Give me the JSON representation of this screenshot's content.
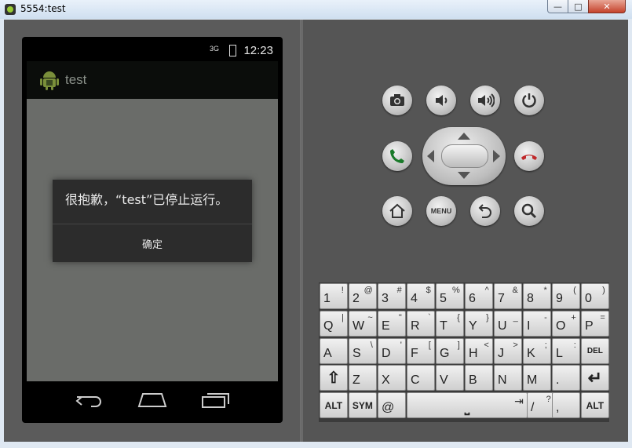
{
  "window": {
    "title": "5554:test",
    "minimize": "—",
    "maximize": "□",
    "close": "✕"
  },
  "statusbar": {
    "time": "12:23",
    "network": "3G"
  },
  "app": {
    "title": "test"
  },
  "dialog": {
    "message": "很抱歉，“test”已停止运行。",
    "ok_label": "确定"
  },
  "controls": {
    "menu_label": "MENU"
  },
  "keyboard": {
    "row1": [
      {
        "main": "1",
        "alt": "!"
      },
      {
        "main": "2",
        "alt": "@"
      },
      {
        "main": "3",
        "alt": "#"
      },
      {
        "main": "4",
        "alt": "$"
      },
      {
        "main": "5",
        "alt": "%"
      },
      {
        "main": "6",
        "alt": "^"
      },
      {
        "main": "7",
        "alt": "&"
      },
      {
        "main": "8",
        "alt": "*"
      },
      {
        "main": "9",
        "alt": "("
      },
      {
        "main": "0",
        "alt": ")"
      }
    ],
    "row2": [
      {
        "main": "Q",
        "alt": "|"
      },
      {
        "main": "W",
        "alt": "~"
      },
      {
        "main": "E",
        "alt": "\""
      },
      {
        "main": "R",
        "alt": "`"
      },
      {
        "main": "T",
        "alt": "{"
      },
      {
        "main": "Y",
        "alt": "}"
      },
      {
        "main": "U",
        "alt": "_"
      },
      {
        "main": "I",
        "alt": "-"
      },
      {
        "main": "O",
        "alt": "+"
      },
      {
        "main": "P",
        "alt": "="
      }
    ],
    "row3": [
      {
        "main": "A",
        "alt": ""
      },
      {
        "main": "S",
        "alt": "\\"
      },
      {
        "main": "D",
        "alt": "'"
      },
      {
        "main": "F",
        "alt": "["
      },
      {
        "main": "G",
        "alt": "]"
      },
      {
        "main": "H",
        "alt": "<"
      },
      {
        "main": "J",
        "alt": ">"
      },
      {
        "main": "K",
        "alt": ";"
      },
      {
        "main": "L",
        "alt": ":"
      },
      {
        "main": "DEL",
        "alt": ""
      }
    ],
    "row4": [
      {
        "main": "⇧",
        "alt": ""
      },
      {
        "main": "Z",
        "alt": ""
      },
      {
        "main": "X",
        "alt": ""
      },
      {
        "main": "C",
        "alt": ""
      },
      {
        "main": "V",
        "alt": ""
      },
      {
        "main": "B",
        "alt": ""
      },
      {
        "main": "N",
        "alt": ""
      },
      {
        "main": "M",
        "alt": ""
      },
      {
        "main": ".",
        "alt": ""
      },
      {
        "main": "↵",
        "alt": ""
      }
    ],
    "row5": {
      "alt_left": "ALT",
      "sym": "SYM",
      "at": "@",
      "space": "⎵",
      "tab": "⇥",
      "slash": "/",
      "slash_alt": "?",
      "comma": ",",
      "comma_alt": "",
      "alt_right": "ALT"
    }
  }
}
